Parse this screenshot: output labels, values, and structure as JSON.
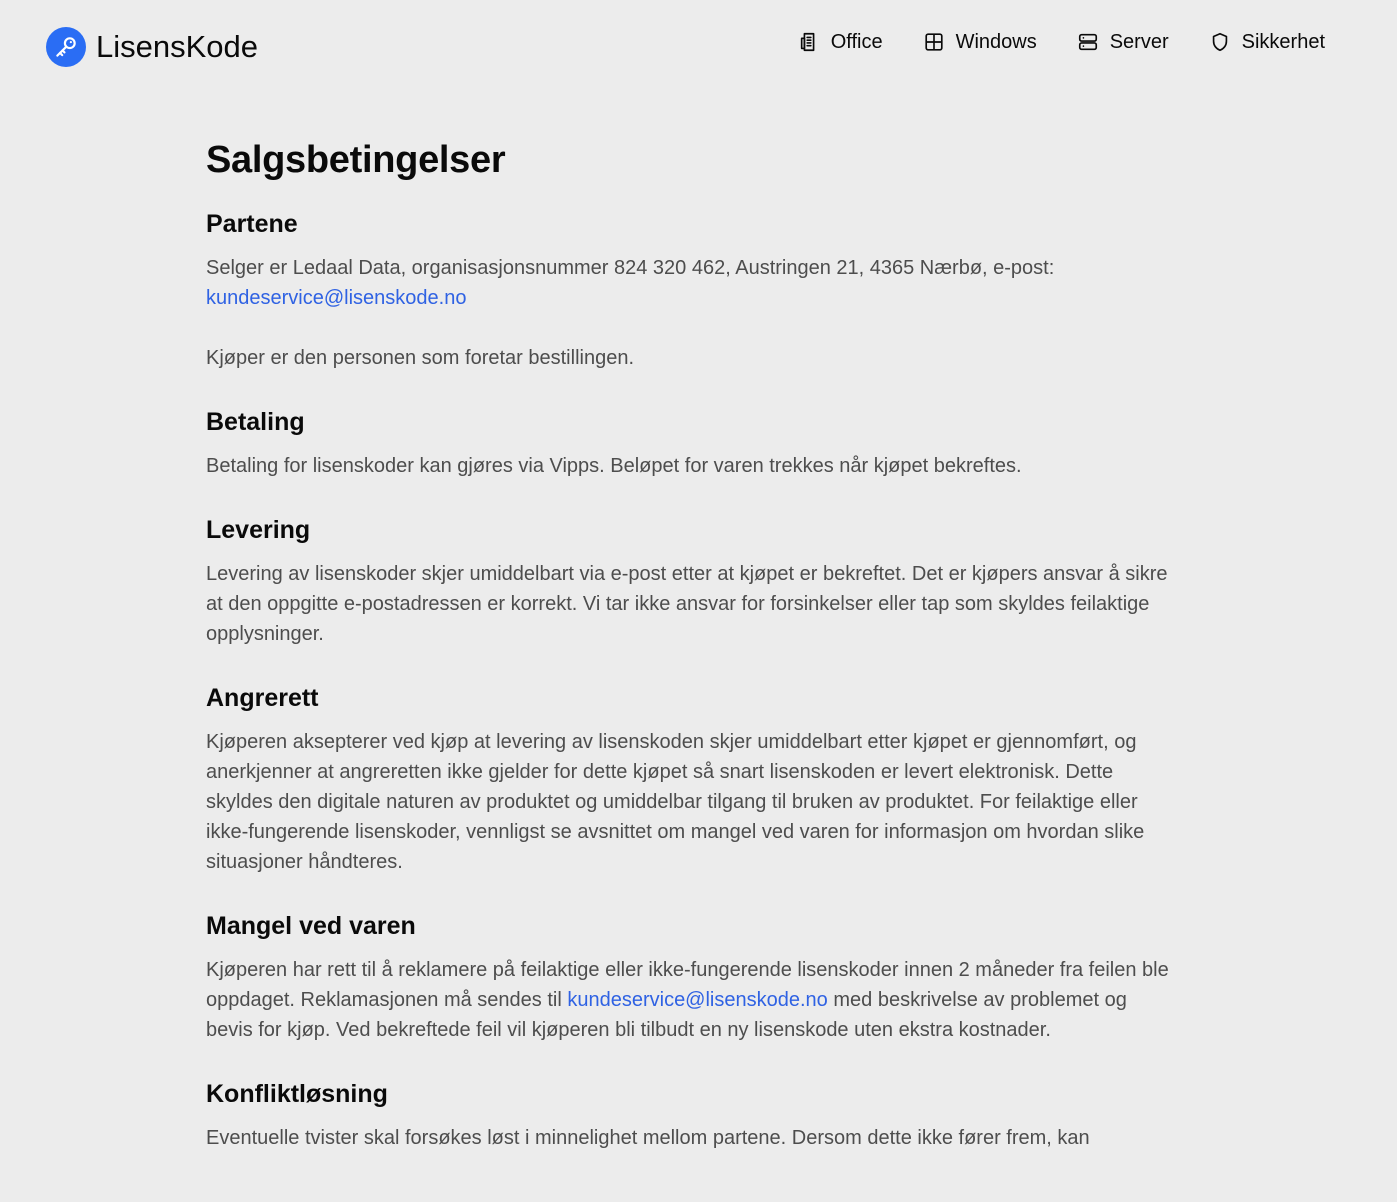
{
  "header": {
    "brand": "LisensKode",
    "nav": [
      {
        "label": "Office",
        "icon": "office-icon"
      },
      {
        "label": "Windows",
        "icon": "windows-icon"
      },
      {
        "label": "Server",
        "icon": "server-icon"
      },
      {
        "label": "Sikkerhet",
        "icon": "shield-icon"
      }
    ]
  },
  "colors": {
    "background": "#ececec",
    "accent": "#2a6df4",
    "link": "#2f62e3"
  },
  "page": {
    "title": "Salgsbetingelser",
    "sections": [
      {
        "heading": "Partene",
        "p1_text": "Selger er Ledaal Data, organisasjonsnummer 824 320 462, Austringen 21, 4365 Nærbø, e-post:",
        "p1_link": "kundeservice@lisenskode.no",
        "p2_text": "Kjøper er den personen som foretar bestillingen."
      },
      {
        "heading": "Betaling",
        "text": "Betaling for lisenskoder kan gjøres via Vipps. Beløpet for varen trekkes når kjøpet bekreftes."
      },
      {
        "heading": "Levering",
        "text": "Levering av lisenskoder skjer umiddelbart via e-post etter at kjøpet er bekreftet. Det er kjøpers ansvar å sikre at den oppgitte e-postadressen er korrekt. Vi tar ikke ansvar for forsinkelser eller tap som skyldes feilaktige opplysninger."
      },
      {
        "heading": "Angrerett",
        "text": "Kjøperen aksepterer ved kjøp at levering av lisenskoden skjer umiddelbart etter kjøpet er gjennomført, og anerkjenner at angreretten ikke gjelder for dette kjøpet så snart lisenskoden er levert elektronisk. Dette skyldes den digitale naturen av produktet og umiddelbar tilgang til bruken av produktet. For feilaktige eller ikke-fungerende lisenskoder, vennligst se avsnittet om mangel ved varen for informasjon om hvordan slike situasjoner håndteres."
      },
      {
        "heading": "Mangel ved varen",
        "text_before": "Kjøperen har rett til å reklamere på feilaktige eller ikke-fungerende lisenskoder innen 2 måneder fra feilen ble oppdaget. Reklamasjonen må sendes til",
        "link": "kundeservice@lisenskode.no",
        "text_after": "med beskrivelse av problemet og bevis for kjøp. Ved bekreftede feil vil kjøperen bli tilbudt en ny lisenskode uten ekstra kostnader."
      },
      {
        "heading": "Konfliktløsning",
        "text": "Eventuelle tvister skal forsøkes løst i minnelighet mellom partene. Dersom dette ikke fører frem, kan"
      }
    ]
  }
}
